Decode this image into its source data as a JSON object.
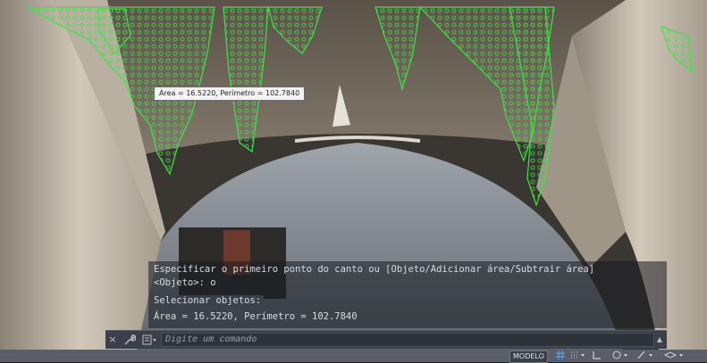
{
  "viewport": {
    "measurement_tooltip": "Área = 16.5220, Perímetro = 102.7840"
  },
  "command_history": {
    "lines": [
      "Especificar o primeiro ponto do canto ou [Objeto/Adicionar área/Subtrair área]",
      "<Objeto>: o",
      "Selecionar objetos:",
      "Área = 16.5220, Perímetro = 102.7840"
    ]
  },
  "command_line": {
    "close_icon": "×",
    "settings_icon": "wrench",
    "recent_icon": "recent-commands",
    "input_placeholder": "Digite um comando",
    "scroll_icon": "▲"
  },
  "status_bar": {
    "model_tab_label": "MODELO",
    "icons": [
      "grid-icon",
      "snap-icon",
      "ortho-icon",
      "polar-icon",
      "osnap-icon",
      "isodraft-icon"
    ]
  },
  "colors": {
    "contour_green": "#41e14a",
    "panel_dark": "#2f3339",
    "status_bg": "#5a5f67"
  }
}
